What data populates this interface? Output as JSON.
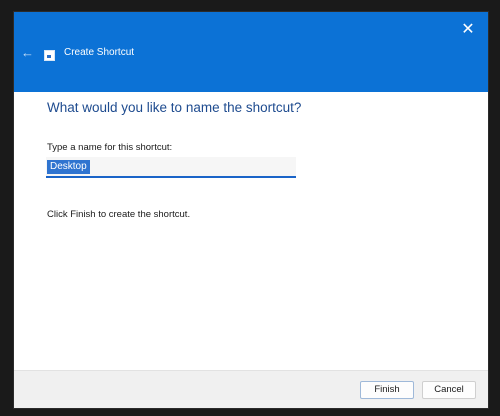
{
  "window": {
    "title": "Create Shortcut",
    "close_glyph": "✕",
    "back_glyph": "←",
    "icons": [
      "back-arrow-icon",
      "shortcut-wizard-icon",
      "close-icon"
    ]
  },
  "main": {
    "heading": "What would you like to name the shortcut?",
    "field_label": "Type a name for this shortcut:",
    "name_value": "Desktop",
    "hint": "Click Finish to create the shortcut."
  },
  "footer": {
    "finish_label": "Finish",
    "cancel_label": "Cancel"
  },
  "colors": {
    "titlebar": "#0c72d6",
    "heading": "#1e4b8f",
    "selection": "#2f74d0",
    "input_underline": "#1a64c8"
  }
}
